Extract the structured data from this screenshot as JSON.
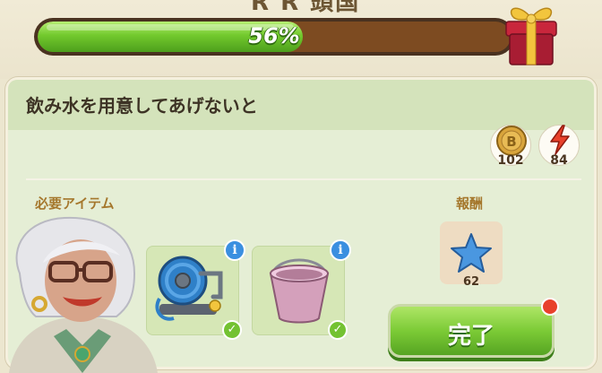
{
  "header": {
    "title": "R R 頭国",
    "progress_label": "56%",
    "progress_fraction": 0.56
  },
  "task": {
    "title": "飲み水を用意してあげないと"
  },
  "stats": {
    "coin_value": "102",
    "coin_icon": "b-coin-icon",
    "energy_value": "84",
    "energy_icon": "lightning-icon"
  },
  "sections": {
    "required_items_label": "必要アイテム",
    "reward_label": "報酬"
  },
  "items": [
    {
      "name": "hose-reel",
      "info": "i"
    },
    {
      "name": "bucket",
      "info": "i"
    }
  ],
  "reward": {
    "icon": "blue-star-icon",
    "value": "62"
  },
  "button": {
    "complete_label": "完了"
  },
  "colors": {
    "progress_green": "#72c92d",
    "progress_track": "#7d4b21",
    "button_green": "#7ccb36",
    "info_blue": "#3a8fe0",
    "notification_red": "#e8412b",
    "panel_bg": "#e5eed5"
  }
}
